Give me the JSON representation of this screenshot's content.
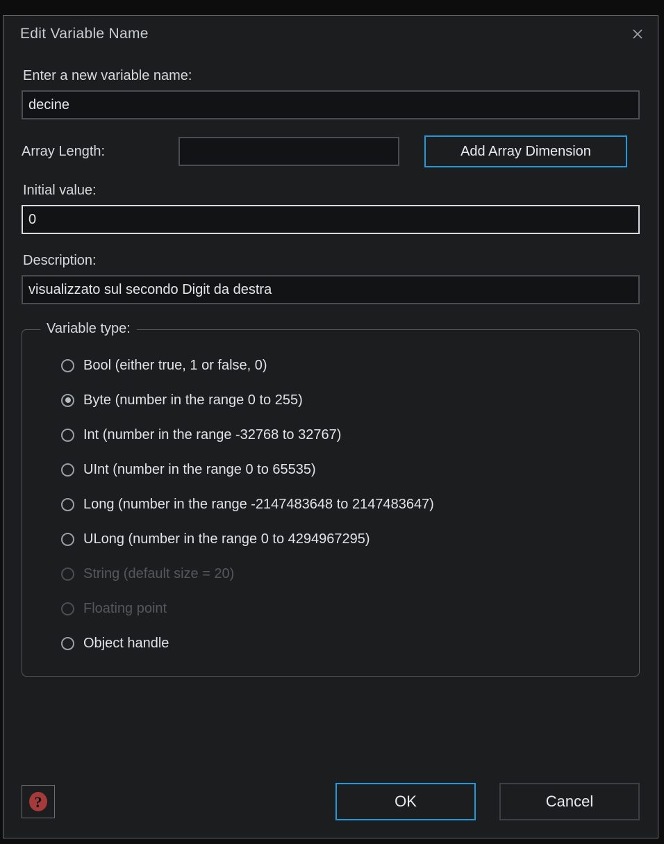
{
  "dialog": {
    "title": "Edit Variable Name",
    "close_icon": "close-icon"
  },
  "fields": {
    "name_label": "Enter a new variable name:",
    "name_value": "decine",
    "array_length_label": "Array Length:",
    "array_length_value": "",
    "add_array_dimension_label": "Add Array Dimension",
    "initial_value_label": "Initial value:",
    "initial_value": "0",
    "description_label": "Description:",
    "description_value": "visualizzato sul secondo Digit da destra"
  },
  "variable_type": {
    "group_label": "Variable type:",
    "options": [
      {
        "label": "Bool (either true, 1 or false, 0)",
        "selected": false,
        "disabled": false,
        "name": "radio-bool"
      },
      {
        "label": "Byte (number in the range 0 to 255)",
        "selected": true,
        "disabled": false,
        "name": "radio-byte"
      },
      {
        "label": "Int (number in the range -32768 to 32767)",
        "selected": false,
        "disabled": false,
        "name": "radio-int"
      },
      {
        "label": "UInt (number in the range 0 to 65535)",
        "selected": false,
        "disabled": false,
        "name": "radio-uint"
      },
      {
        "label": "Long (number in the range -2147483648 to 2147483647)",
        "selected": false,
        "disabled": false,
        "name": "radio-long"
      },
      {
        "label": "ULong (number in the range 0 to 4294967295)",
        "selected": false,
        "disabled": false,
        "name": "radio-ulong"
      },
      {
        "label": "String (default size = 20)",
        "selected": false,
        "disabled": true,
        "name": "radio-string"
      },
      {
        "label": "Floating point",
        "selected": false,
        "disabled": true,
        "name": "radio-floating-point"
      },
      {
        "label": "Object handle",
        "selected": false,
        "disabled": false,
        "name": "radio-object-handle"
      }
    ]
  },
  "footer": {
    "help_icon": "help-icon",
    "help_glyph": "?",
    "ok_label": "OK",
    "cancel_label": "Cancel"
  },
  "colors": {
    "accent": "#1f9bdd",
    "dialog_bg": "#1b1d1e",
    "input_bg": "#121314",
    "help_red": "#a53a3a"
  }
}
